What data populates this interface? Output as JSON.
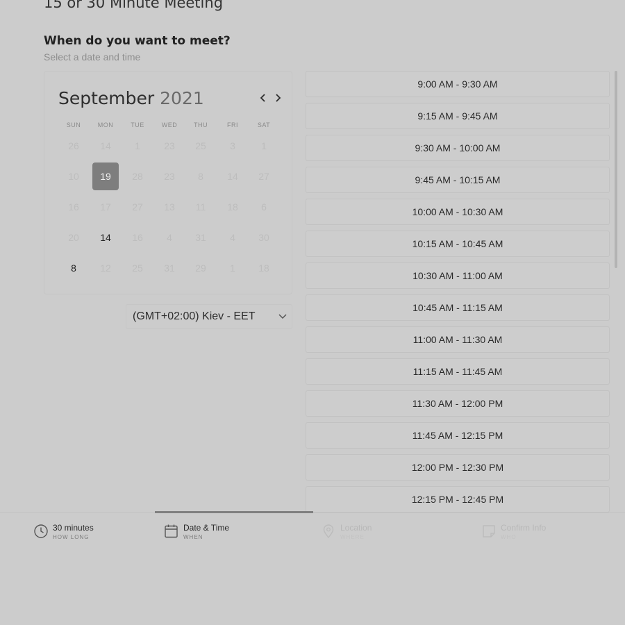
{
  "page": {
    "title": "15 or 30 Minute Meeting"
  },
  "prompt": {
    "heading": "When do you want to meet?",
    "subheading": "Select a date and time"
  },
  "calendar": {
    "month": "September",
    "year": "2021",
    "weekdays": [
      "SUN",
      "MON",
      "TUE",
      "WED",
      "THU",
      "FRI",
      "SAT"
    ],
    "weeks": [
      [
        "26",
        "14",
        "1",
        "23",
        "25",
        "3",
        "1"
      ],
      [
        "10",
        "19",
        "28",
        "23",
        "8",
        "14",
        "27"
      ],
      [
        "16",
        "17",
        "27",
        "13",
        "11",
        "18",
        "6"
      ],
      [
        "20",
        "14",
        "16",
        "4",
        "31",
        "4",
        "30"
      ],
      [
        "8",
        "12",
        "25",
        "31",
        "29",
        "1",
        "18"
      ]
    ],
    "selected_day": "19",
    "prev_icon": "chevron-left-icon",
    "next_icon": "chevron-right-icon"
  },
  "timezone": {
    "value": "(GMT+02:00) Kiev - EET",
    "icon": "chevron-down-icon"
  },
  "time_slots": [
    "9:00 AM - 9:30 AM",
    "9:15 AM - 9:45 AM",
    "9:30 AM - 10:00 AM",
    "9:45 AM - 10:15 AM",
    "10:00 AM - 10:30 AM",
    "10:15 AM - 10:45 AM",
    "10:30 AM - 11:00 AM",
    "10:45 AM - 11:15 AM",
    "11:00 AM - 11:30 AM",
    "11:15 AM - 11:45 AM",
    "11:30 AM - 12:00 PM",
    "11:45 AM - 12:15 PM",
    "12:00 PM - 12:30 PM",
    "12:15 PM - 12:45 PM"
  ],
  "steps": [
    {
      "label": "30 minutes",
      "sub": "HOW LONG",
      "icon": "clock-icon",
      "state": "done"
    },
    {
      "label": "Date & Time",
      "sub": "WHEN",
      "icon": "calendar-icon",
      "state": "active"
    },
    {
      "label": "Location",
      "sub": "WHERE",
      "icon": "location-pin-icon",
      "state": "disabled"
    },
    {
      "label": "Confirm Info",
      "sub": "WHO",
      "icon": "note-icon",
      "state": "disabled"
    }
  ],
  "colors": {
    "background": "#cccccc",
    "selected_day": "#7e7e7e",
    "active_step_indicator": "#808080"
  }
}
